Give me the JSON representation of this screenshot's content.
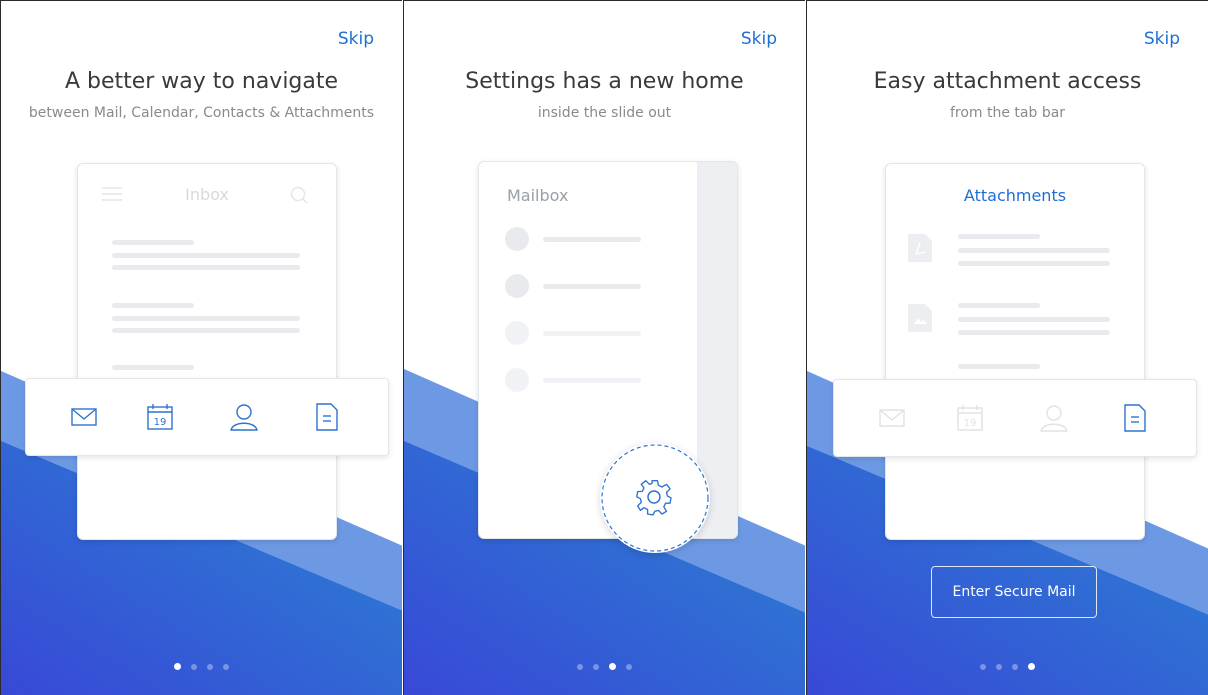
{
  "slides": [
    {
      "skip_label": "Skip",
      "title": "A better way to navigate",
      "subtitle": "between Mail, Calendar, Contacts & Attachments",
      "mock_header_title": "Inbox",
      "calendar_day": "19",
      "tab_icons": [
        "mail-icon",
        "calendar-icon",
        "contacts-icon",
        "attachments-icon"
      ]
    },
    {
      "skip_label": "Skip",
      "title": "Settings has a new home",
      "subtitle": "inside the slide out",
      "mock_header_title": "Mailbox",
      "highlight_icon": "gear-icon"
    },
    {
      "skip_label": "Skip",
      "title": "Easy attachment access",
      "subtitle": "from the tab bar",
      "mock_header_title": "Attachments",
      "calendar_day": "19",
      "button_label": "Enter Secure Mail",
      "tab_icons": [
        "mail-icon",
        "calendar-icon",
        "contacts-icon",
        "attachments-icon"
      ]
    }
  ],
  "pagination": {
    "total": 4,
    "active_by_slide": [
      1,
      3,
      4
    ]
  },
  "colors": {
    "accent": "#1e6fd2",
    "gradient_start": "#3a4fd8",
    "gradient_end": "#2a7fd0",
    "band_light": "#6aa0e6",
    "muted_bar": "#e8eaee"
  }
}
